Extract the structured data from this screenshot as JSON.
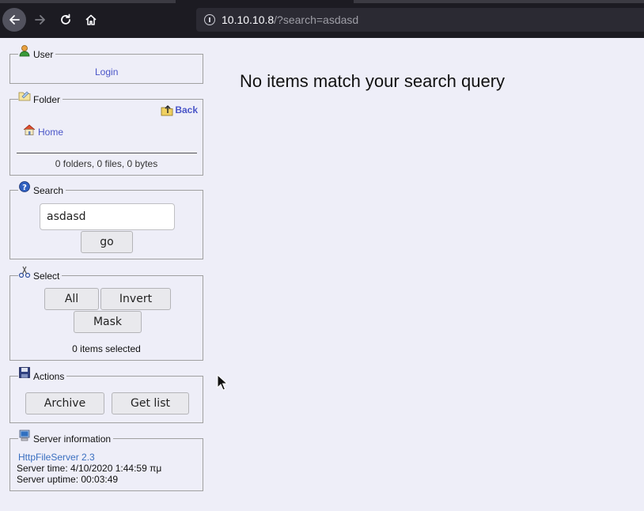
{
  "browser": {
    "url_host": "10.10.10.8",
    "url_path": "/?search=asdasd"
  },
  "user_panel": {
    "legend": "User",
    "login_link": "Login"
  },
  "folder_panel": {
    "legend": "Folder",
    "back_link": "Back",
    "home_link": "Home",
    "summary": "0 folders, 0 files, 0 bytes"
  },
  "search_panel": {
    "legend": "Search",
    "query_value": "asdasd",
    "go_label": "go"
  },
  "select_panel": {
    "legend": "Select",
    "all_label": "All",
    "invert_label": "Invert",
    "mask_label": "Mask",
    "status": "0 items selected"
  },
  "actions_panel": {
    "legend": "Actions",
    "archive_label": "Archive",
    "getlist_label": "Get list"
  },
  "server_panel": {
    "legend": "Server information",
    "product_link": "HttpFileServer 2.3",
    "server_time": "Server time: 4/10/2020 1:44:59 πμ",
    "server_uptime": "Server uptime: 00:03:49"
  },
  "main": {
    "message": "No items match your search query"
  }
}
